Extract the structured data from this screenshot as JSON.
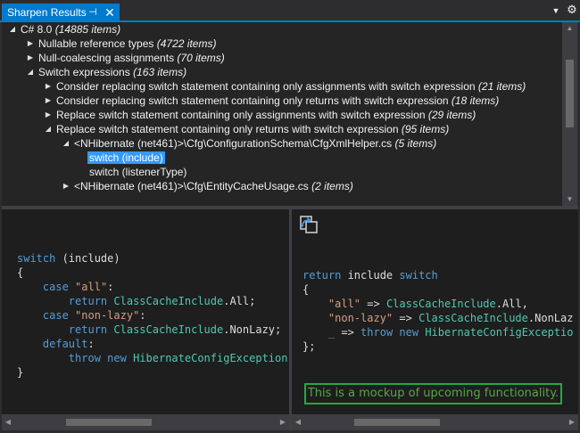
{
  "window": {
    "tab_title": "Sharpen Results",
    "pin_glyph": "⊣",
    "close_glyph": "✕",
    "menu_glyph": "▼",
    "gear_glyph": "⚙"
  },
  "tree": {
    "rows": [
      {
        "label": "C# 8.0",
        "count": "(14885 items)",
        "expanded": true
      },
      {
        "label": "Nullable reference types",
        "count": "(4722 items)",
        "expanded": false
      },
      {
        "label": "Null-coalescing assignments",
        "count": "(70 items)",
        "expanded": false
      },
      {
        "label": "Switch expressions",
        "count": "(163 items)",
        "expanded": true
      },
      {
        "label": "Consider replacing switch statement containing only assignments with switch expression",
        "count": "(21 items)",
        "expanded": false
      },
      {
        "label": "Consider replacing switch statement containing only returns with switch expression",
        "count": "(18 items)",
        "expanded": false
      },
      {
        "label": "Replace switch statement containing only assignments with switch expression",
        "count": "(29 items)",
        "expanded": false
      },
      {
        "label": "Replace switch statement containing only returns with switch expression",
        "count": "(95 items)",
        "expanded": true
      },
      {
        "label": "<NHibernate (net461)>\\Cfg\\ConfigurationSchema\\CfgXmlHelper.cs",
        "count": "(5 items)",
        "expanded": true
      },
      {
        "label": "switch (include)",
        "count": "",
        "selected": true
      },
      {
        "label": "switch (listenerType)",
        "count": ""
      },
      {
        "label": "<NHibernate (net461)>\\Cfg\\EntityCacheUsage.cs",
        "count": "(2 items)",
        "expanded": false
      }
    ]
  },
  "before_code": {
    "l1_kw": "switch",
    "l1_rest": " (include)",
    "l2": "{",
    "l3_kw": "case",
    "l3_str": "\"all\"",
    "l3_rest": ":",
    "l4_kw": "return",
    "l4_typ": "ClassCacheInclude",
    "l4_rest": ".All;",
    "l5_kw": "case",
    "l5_str": "\"non-lazy\"",
    "l5_rest": ":",
    "l6_kw": "return",
    "l6_typ": "ClassCacheInclude",
    "l6_rest": ".NonLazy;",
    "l7_kw": "default",
    "l7_rest": ":",
    "l8_kw1": "throw",
    "l8_kw2": "new",
    "l8_typ": "HibernateConfigException",
    "l8_rest": "(",
    "l9": "}"
  },
  "after_code": {
    "l1_kw1": "return",
    "l1_mid": " include ",
    "l1_kw2": "switch",
    "l2": "{",
    "l3_str": "\"all\"",
    "l3_mid": " => ",
    "l3_typ": "ClassCacheInclude",
    "l3_rest": ".All,",
    "l4_str": "\"non-lazy\"",
    "l4_mid": " => ",
    "l4_typ": "ClassCacheInclude",
    "l4_rest": ".NonLaz",
    "l5_kw1": "_",
    "l5_mid": " => ",
    "l5_kw2": "throw",
    "l5_kw3": "new",
    "l5_typ": "HibernateConfigExceptio",
    "l6": "};"
  },
  "mockup_note": "This is a mockup of upcoming functionality.",
  "colors": {
    "accent": "#007acc",
    "selection": "#3399ff",
    "keyword": "#569cd6",
    "string": "#d69d85",
    "type": "#4ec9b0",
    "note_border": "#22aa44",
    "note_text": "#57a64a"
  },
  "icons": {
    "apply_fix": "apply-fix-icon"
  }
}
